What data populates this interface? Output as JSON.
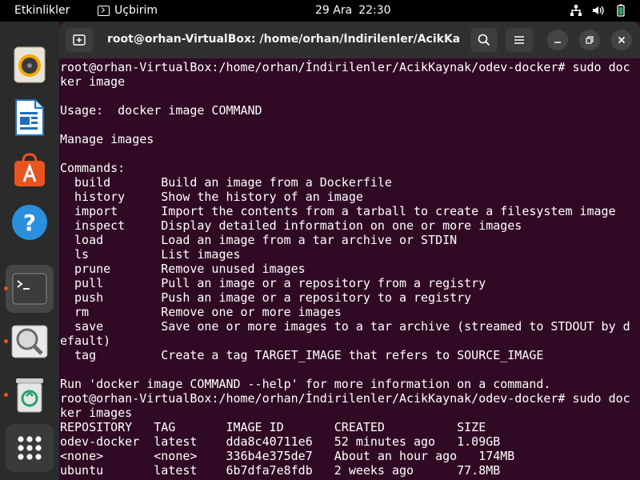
{
  "topbar": {
    "activities": "Etkinlikler",
    "focused_app": "Uçbirim",
    "date": "29 Ara",
    "time": "22:30",
    "tray_icons": [
      "network-icon",
      "volume-icon",
      "battery-icon"
    ]
  },
  "dock": {
    "items": [
      {
        "name": "rhythmbox",
        "icon": "speaker-icon",
        "running": false
      },
      {
        "name": "libreoffice-writer",
        "icon": "document-icon",
        "running": false
      },
      {
        "name": "ubuntu-software",
        "icon": "shopping-bag-icon",
        "running": false
      },
      {
        "name": "help",
        "icon": "question-icon",
        "running": false
      },
      {
        "name": "terminal",
        "icon": "terminal-icon",
        "running": true,
        "active": true
      },
      {
        "name": "image-viewer",
        "icon": "magnifier-icon",
        "running": true
      },
      {
        "name": "trash",
        "icon": "trash-icon",
        "running": true
      }
    ],
    "show_apps": "app-grid-icon"
  },
  "terminal": {
    "title": "root@orhan-VirtualBox: /home/orhan/İndirilenler/AcikKay...",
    "background": "#300a24",
    "lines": [
      "root@orhan-VirtualBox:/home/orhan/İndirilenler/AcikKaynak/odev-docker# sudo doc",
      "ker image",
      "",
      "Usage:  docker image COMMAND",
      "",
      "Manage images",
      "",
      "Commands:",
      "  build       Build an image from a Dockerfile",
      "  history     Show the history of an image",
      "  import      Import the contents from a tarball to create a filesystem image",
      "  inspect     Display detailed information on one or more images",
      "  load        Load an image from a tar archive or STDIN",
      "  ls          List images",
      "  prune       Remove unused images",
      "  pull        Pull an image or a repository from a registry",
      "  push        Push an image or a repository to a registry",
      "  rm          Remove one or more images",
      "  save        Save one or more images to a tar archive (streamed to STDOUT by d",
      "efault)",
      "  tag         Create a tag TARGET_IMAGE that refers to SOURCE_IMAGE",
      "",
      "Run 'docker image COMMAND --help' for more information on a command.",
      "root@orhan-VirtualBox:/home/orhan/İndirilenler/AcikKaynak/odev-docker# sudo doc",
      "ker images",
      "REPOSITORY   TAG       IMAGE ID       CREATED          SIZE",
      "odev-docker  latest    dda8c40711e6   52 minutes ago   1.09GB",
      "<none>       <none>    336b4e375de7   About an hour ago   174MB",
      "ubuntu       latest    6b7dfa7e8fdb   2 weeks ago      77.8MB"
    ]
  }
}
